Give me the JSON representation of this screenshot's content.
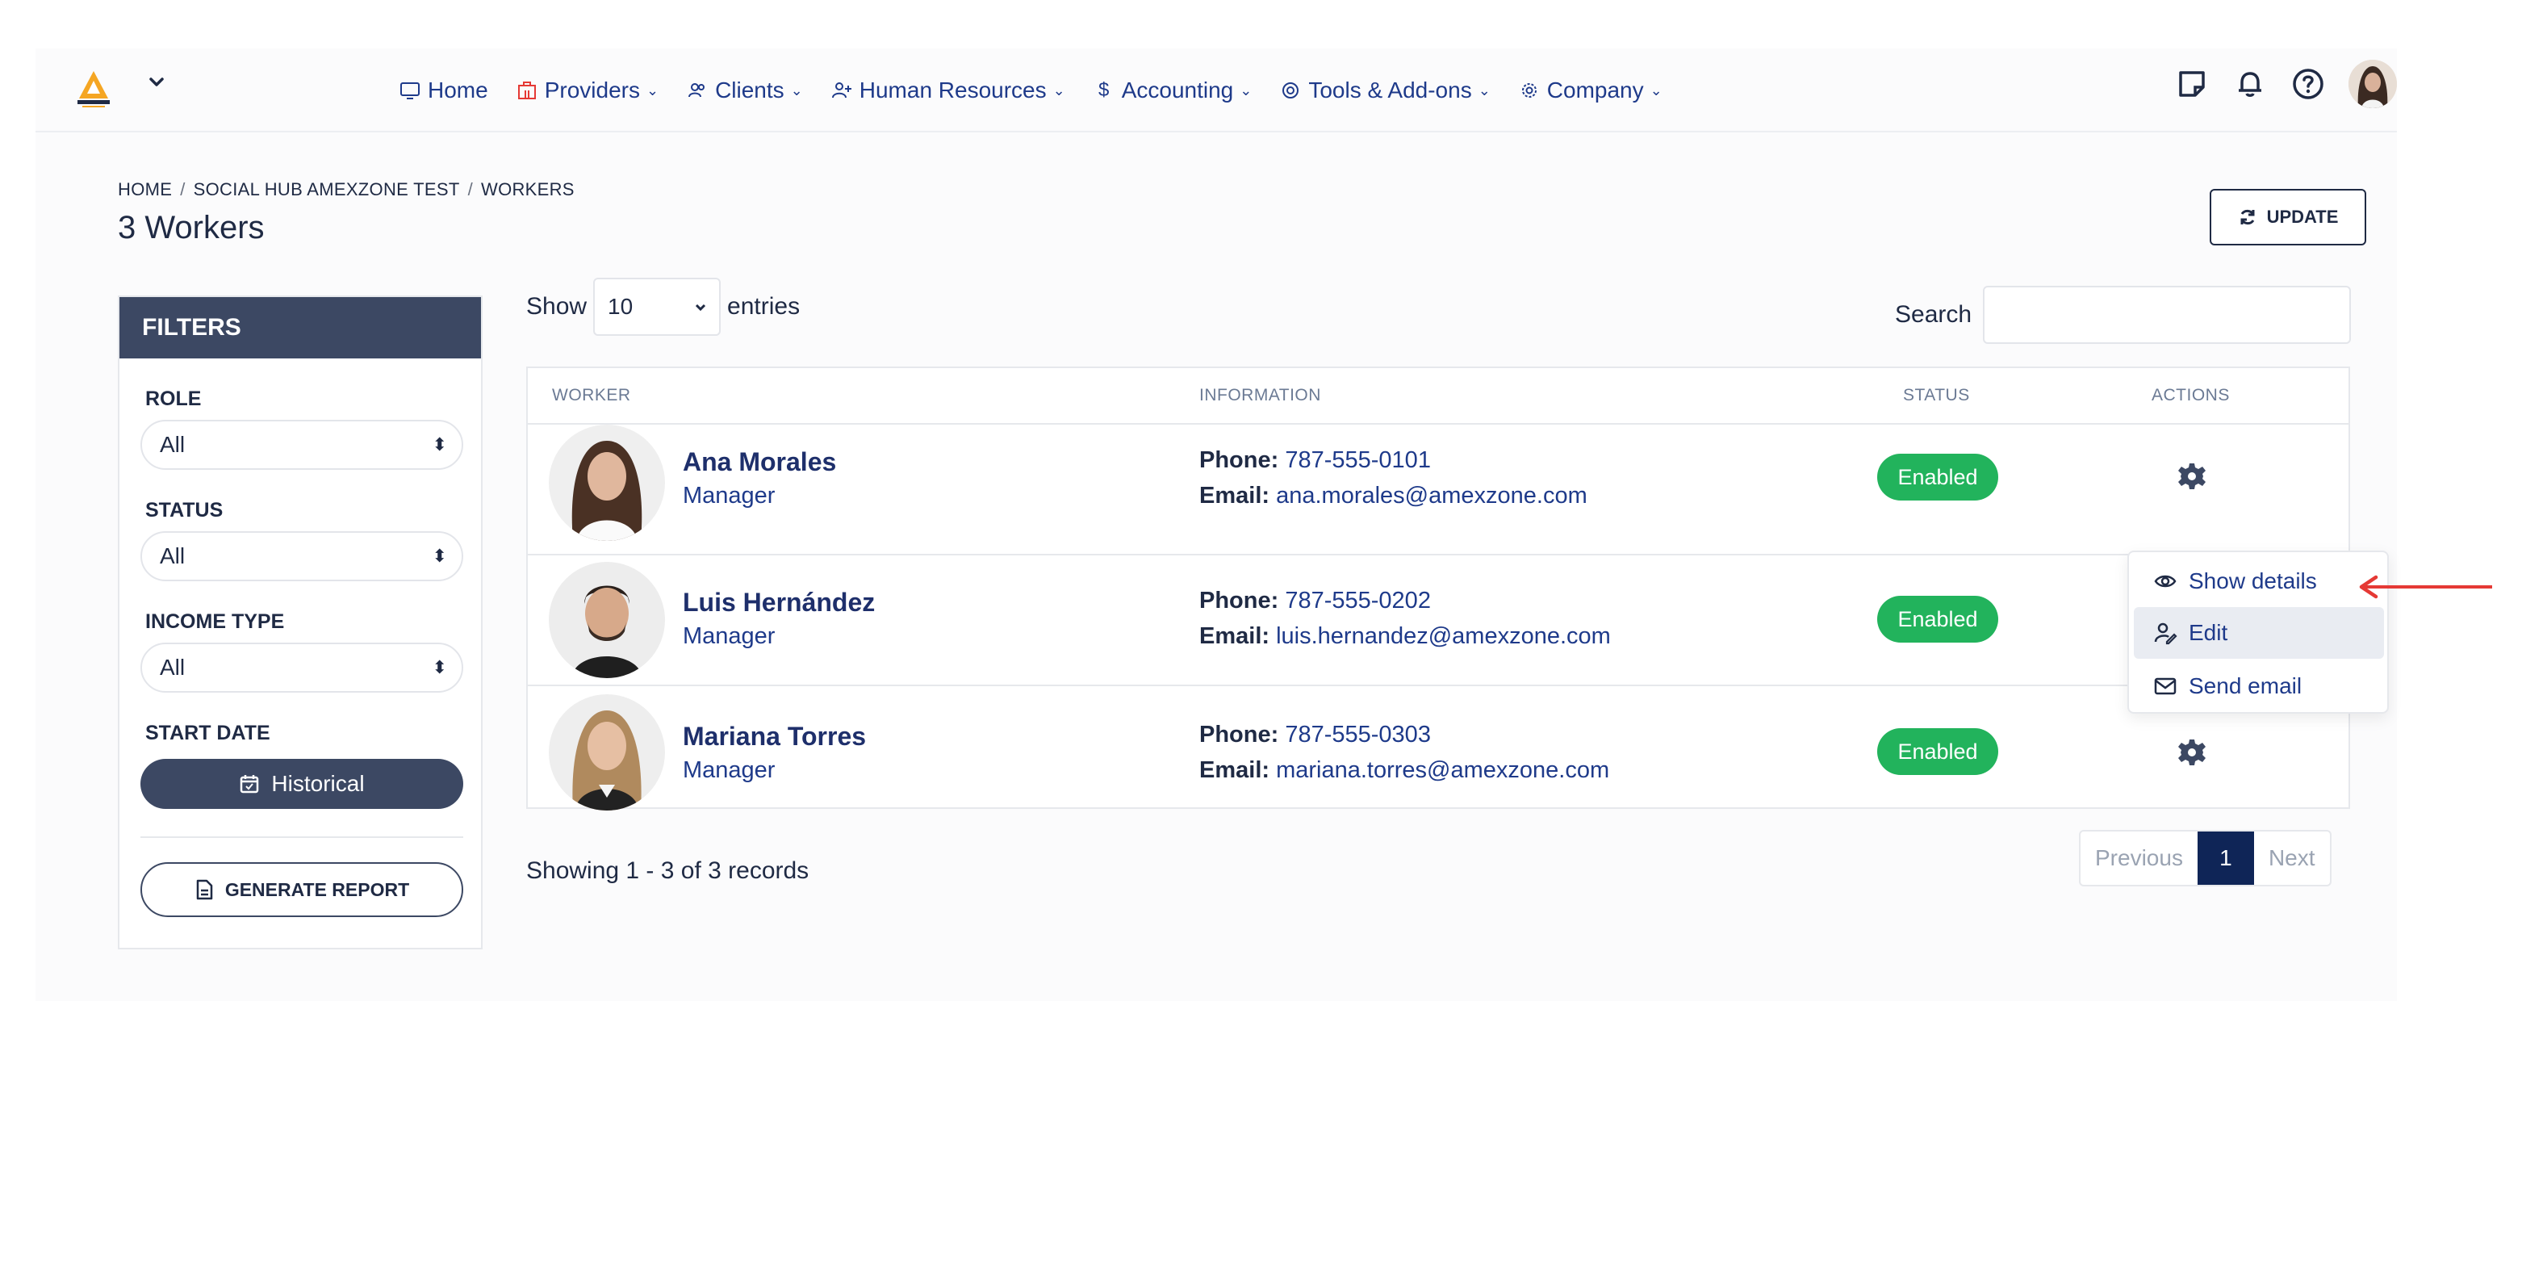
{
  "nav": {
    "home": "Home",
    "providers": "Providers",
    "clients": "Clients",
    "human_resources": "Human Resources",
    "accounting": "Accounting",
    "tools": "Tools & Add-ons",
    "company": "Company"
  },
  "breadcrumb": {
    "home": "HOME",
    "hub": "SOCIAL HUB AMEXZONE TEST",
    "current": "WORKERS"
  },
  "page": {
    "title": "3 Workers",
    "update_label": "UPDATE"
  },
  "filters": {
    "title": "FILTERS",
    "role_label": "ROLE",
    "role_value": "All",
    "status_label": "STATUS",
    "status_value": "All",
    "income_label": "INCOME TYPE",
    "income_value": "All",
    "start_label": "START DATE",
    "historical_label": "Historical",
    "report_label": "GENERATE REPORT"
  },
  "table_controls": {
    "show": "Show",
    "entries_value": "10",
    "entries": "entries",
    "search_label": "Search",
    "search_value": ""
  },
  "table": {
    "headers": {
      "worker": "WORKER",
      "information": "INFORMATION",
      "status": "STATUS",
      "actions": "ACTIONS"
    },
    "rows": [
      {
        "name": "Ana Morales",
        "role": "Manager",
        "phone_label": "Phone:",
        "phone": "787-555-0101",
        "email_label": "Email:",
        "email": "ana.morales@amexzone.com",
        "status": "Enabled"
      },
      {
        "name": "Luis Hernández",
        "role": "Manager",
        "phone_label": "Phone:",
        "phone": "787-555-0202",
        "email_label": "Email:",
        "email": "luis.hernandez@amexzone.com",
        "status": "Enabled"
      },
      {
        "name": "Mariana Torres",
        "role": "Manager",
        "phone_label": "Phone:",
        "phone": "787-555-0303",
        "email_label": "Email:",
        "email": "mariana.torres@amexzone.com",
        "status": "Enabled"
      }
    ]
  },
  "dropdown": {
    "show_details": "Show details",
    "edit": "Edit",
    "send_email": "Send email"
  },
  "footer": {
    "records": "Showing 1 - 3 of 3 records",
    "previous": "Previous",
    "page": "1",
    "next": "Next"
  },
  "colors": {
    "navy": "#3c4863",
    "brand": "#1e3a8a",
    "enabled": "#22b35c",
    "active_page": "#0f2557",
    "arrow": "#e53935"
  }
}
